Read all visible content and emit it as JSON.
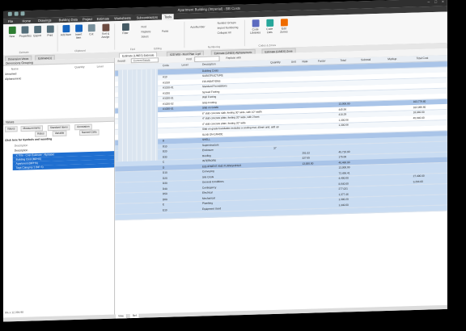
{
  "app": {
    "title": "Apartment Building (Imperial) - BB Costx",
    "menu_tabs": [
      "File",
      "Home",
      "Drawings",
      "Building Data",
      "Project",
      "Estimate",
      "Worksheets",
      "Subcontractors",
      "Tools"
    ],
    "context_tab": "Estimate"
  },
  "ribbon": {
    "buttons": [
      {
        "label": "New",
        "color": "#2e7d32"
      },
      {
        "label": "Properties",
        "color": "#546e7a"
      },
      {
        "label": "Export",
        "color": "#546e7a"
      },
      {
        "label": "Print",
        "color": "#546e7a"
      },
      {
        "label": "Add Item",
        "color": "#1565c0"
      },
      {
        "label": "Insert Item",
        "color": "#1565c0"
      },
      {
        "label": "Cut",
        "color": "#78909c"
      },
      {
        "label": "Sort & Assign",
        "color": "#6d4c41"
      },
      {
        "label": "Filter",
        "color": "#455a64"
      }
    ],
    "groups": [
      "Estimate",
      "Clipboard",
      "Editing",
      "Numbering",
      "Find",
      "Codes & Zones"
    ],
    "small_items": [
      "Find",
      "Replace",
      "Select",
      "Paste",
      "AutoNumber",
      "Number Groups",
      "Import Numbering",
      "Collapse All"
    ],
    "right_buttons": [
      "Code Libraries",
      "Code Lists",
      "Edit Zones"
    ]
  },
  "doc_tabs": [
    "Dimension Views",
    "Estimate(1)",
    "Estimate (LINES) Estimate",
    "X2D Mtd - Roof Plan 1.gd",
    "Estimate (LINES) Alphanumeric",
    "Estimate (LINES) Zone"
  ],
  "left": {
    "pane1_title": "Dimensions  Grouping",
    "pane1_rows": [
      "Unnamed",
      "Alphanumeric"
    ],
    "pane1_cols": [
      "Name",
      "Quantity",
      "Level"
    ],
    "pane2_title": "Values",
    "pane2_tabs": [
      "Values",
      "Measurements",
      "Standard Items",
      "Annotation"
    ],
    "pane2_sub": [
      "Rates",
      "Variable",
      "Named Cells"
    ],
    "group_header": "Click here for Symbols and rounding",
    "columns_label": "Description",
    "rows": [
      "Description",
      "X Title - Cost Estimate - Alphabet",
      "Building Cost (MPHS)",
      "Apartment (MPHS)",
      "Tags Category 1 (NF S)"
    ],
    "status": "6% x 12,394.90"
  },
  "grid": {
    "filter_label": "Search",
    "filter_value": "Current Estate",
    "find_label": "Find",
    "replace_label": "Replace with",
    "columns": [
      "Code",
      "Level",
      "Description",
      "Quantity",
      "Unit",
      "Rate",
      "Factor",
      "Total",
      "Subtotal",
      "Markup",
      "Total Cost"
    ],
    "rows": [
      {
        "code": "",
        "desc": "Building Costs",
        "qty": "",
        "unit": "",
        "rate": "",
        "total": "",
        "markup": "",
        "cost": "",
        "hl": true
      },
      {
        "code": "A10",
        "desc": "SUBSTRUCTURE",
        "qty": "",
        "unit": "",
        "rate": "",
        "total": "",
        "markup": "",
        "cost": "",
        "hl": false
      },
      {
        "code": "A1010",
        "desc": "FOUNDATIONS",
        "qty": "",
        "unit": "",
        "rate": "",
        "total": "",
        "markup": "",
        "cost": "",
        "hl": false
      },
      {
        "code": "A1010-01",
        "desc": "Standard Foundations",
        "qty": "",
        "unit": "",
        "rate": "",
        "total": "",
        "markup": "",
        "cost": "",
        "hl": false
      },
      {
        "code": "A1020",
        "desc": "Spread Footing",
        "qty": "",
        "unit": "",
        "rate": "",
        "total": "",
        "markup": "",
        "cost": "",
        "hl": false
      },
      {
        "code": "A1020-01",
        "desc": "Wall Footing",
        "qty": "",
        "unit": "",
        "rate": "",
        "total": "",
        "markup": "",
        "cost": "",
        "hl": false
      },
      {
        "code": "A1020-02",
        "desc": "Strip Footing",
        "qty": "",
        "unit": "",
        "rate": "",
        "total": "",
        "markup": "",
        "cost": "",
        "hl": false
      },
      {
        "code": "A1030-01",
        "desc": "Slab on Grade",
        "qty": "",
        "unit": "",
        "rate": "",
        "total": "13,000.00",
        "markup": "",
        "cost": "103,779.60",
        "hl": true
      },
      {
        "code": "",
        "desc": "6\" slab concrete slab, footing 30\" wide, with 10\" width",
        "qty": "",
        "unit": "",
        "rate": "",
        "total": "445.56",
        "markup": "",
        "cost": "102,096.60",
        "hl": false
      },
      {
        "code": "",
        "desc": "4\" slab concrete plate, footing 20\" wide, with 2 bars",
        "qty": "",
        "unit": "",
        "rate": "",
        "total": "410.29",
        "markup": "",
        "cost": "18,040.00",
        "hl": false
      },
      {
        "code": "",
        "desc": "4\" slab concrete plate, footing 20\" wide",
        "qty": "",
        "unit": "",
        "rate": "",
        "total": "1,300.56",
        "markup": "",
        "cost": "45,640.00",
        "hl": false
      },
      {
        "code": "",
        "desc": "Slab on grade foundation includes a cooling mat, 40mm and, add up",
        "qty": "",
        "unit": "",
        "rate": "",
        "total": "1,300.56",
        "markup": "",
        "cost": "",
        "hl": false
      },
      {
        "code": "",
        "desc": "SLAB ON GRADE",
        "qty": "",
        "unit": "",
        "rate": "",
        "total": "",
        "markup": "",
        "cost": "",
        "hl": false
      },
      {
        "code": "B",
        "desc": "SHELL",
        "qty": "",
        "unit": "",
        "rate": "",
        "total": "",
        "markup": "",
        "cost": "",
        "hl": true
      },
      {
        "code": "B10",
        "desc": "Superstructure",
        "qty": "",
        "unit": "",
        "rate": "",
        "total": "",
        "markup": "",
        "cost": "",
        "hl": false
      },
      {
        "code": "B20",
        "desc": "Enclosure",
        "qty": "37",
        "unit": "",
        "rate": "",
        "total": "",
        "markup": "",
        "cost": "",
        "hl": false
      },
      {
        "code": "B30",
        "desc": "Roofing",
        "qty": "",
        "unit": "",
        "rate": "251.02",
        "total": "45,710.00",
        "markup": "",
        "cost": "",
        "hl": false
      },
      {
        "code": "C",
        "desc": "INTERIORS",
        "qty": "",
        "unit": "",
        "rate": "327.65",
        "total": "175.00",
        "markup": "",
        "cost": "",
        "hl": false
      },
      {
        "code": "D",
        "desc": "EQUIPMENT AND FURNISHINGS",
        "qty": "",
        "unit": "",
        "rate": "13,000.00",
        "total": "40,460.00",
        "markup": "",
        "cost": "",
        "hl": true
      },
      {
        "code": "D10",
        "desc": "Conveying",
        "qty": "",
        "unit": "",
        "rate": "",
        "total": "13,000.00",
        "markup": "",
        "cost": "",
        "hl": false
      },
      {
        "code": "D20",
        "desc": "Site Costs",
        "qty": "",
        "unit": "",
        "rate": "",
        "total": "72,456.41",
        "markup": "",
        "cost": "",
        "hl": false
      },
      {
        "code": "D30",
        "desc": "General Conditions",
        "qty": "",
        "unit": "",
        "rate": "",
        "total": "4,400.00",
        "markup": "",
        "cost": "27,400.00",
        "hl": false
      },
      {
        "code": "D40",
        "desc": "Contingency",
        "qty": "",
        "unit": "",
        "rate": "",
        "total": "8,640.00",
        "markup": "",
        "cost": "3,264.00",
        "hl": false
      },
      {
        "code": "D50",
        "desc": "Electrical",
        "qty": "",
        "unit": "",
        "rate": "",
        "total": "277,021",
        "markup": "",
        "cost": "",
        "hl": false
      },
      {
        "code": "D60",
        "desc": "Mechanical",
        "qty": "",
        "unit": "",
        "rate": "",
        "total": "1,377.46",
        "markup": "",
        "cost": "",
        "hl": false
      },
      {
        "code": "E",
        "desc": "Plumbing",
        "qty": "",
        "unit": "",
        "rate": "",
        "total": "1,380.20",
        "markup": "",
        "cost": "",
        "hl": false
      },
      {
        "code": "E10",
        "desc": "Equipment Used",
        "qty": "",
        "unit": "",
        "rate": "",
        "total": "1,340.00",
        "markup": "",
        "cost": "",
        "hl": false
      },
      {
        "code": "",
        "desc": "",
        "qty": "",
        "unit": "",
        "rate": "",
        "total": "",
        "markup": "",
        "cost": "",
        "hl": false
      }
    ],
    "bottom_tabs": [
      "View",
      "Ref"
    ]
  },
  "colors": {
    "accent": "#1f6fd0",
    "rowhl": "#a9c4e8",
    "rowsel": "#7ea8dc",
    "grid_bg": "#c9dcf2"
  }
}
